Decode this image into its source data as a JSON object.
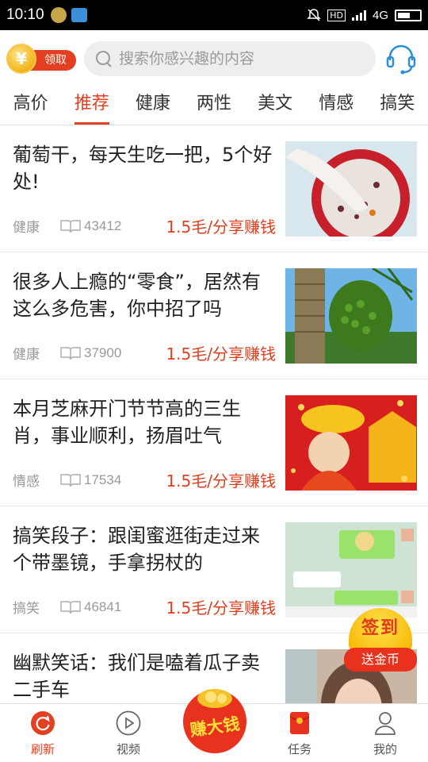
{
  "status_bar": {
    "time": "10:10",
    "hd": "HD",
    "network": "4G"
  },
  "header": {
    "claim_label": "领取",
    "coin_symbol": "¥",
    "search_placeholder": "搜索你感兴趣的内容"
  },
  "tabs": [
    {
      "label": "高价"
    },
    {
      "label": "推荐"
    },
    {
      "label": "健康"
    },
    {
      "label": "两性"
    },
    {
      "label": "美文"
    },
    {
      "label": "情感"
    },
    {
      "label": "搞笑"
    }
  ],
  "active_tab": "推荐",
  "feed": [
    {
      "title": "葡萄干，每天生吃一把，5个好处!",
      "category": "健康",
      "views": "43412",
      "earn": "1.5毛/分享赚钱"
    },
    {
      "title": "很多人上瘾的“零食”，居然有这么多危害，你中招了吗",
      "category": "健康",
      "views": "37900",
      "earn": "1.5毛/分享赚钱"
    },
    {
      "title": "本月芝麻开门节节高的三生肖，事业顺利，扬眉吐气",
      "category": "情感",
      "views": "17534",
      "earn": "1.5毛/分享赚钱"
    },
    {
      "title": "搞笑段子：跟闺蜜逛街走过来个带墨镜，手拿拐杖的",
      "category": "搞笑",
      "views": "46841",
      "earn": "1.5毛/分享赚钱"
    },
    {
      "title": "幽默笑话：我们是嗑着瓜子卖二手车"
    }
  ],
  "signin": {
    "top": "签到",
    "bottom": "送金币"
  },
  "earn_button": "赚大钱",
  "bottom_nav": [
    {
      "label": "刷新"
    },
    {
      "label": "视频"
    },
    {
      "label": "任务"
    },
    {
      "label": "我的"
    }
  ],
  "colors": {
    "accent": "#e24020",
    "earn_text": "#e04020"
  }
}
